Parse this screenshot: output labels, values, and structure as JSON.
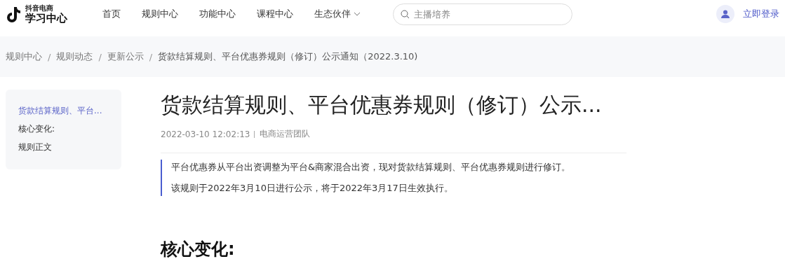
{
  "logo": {
    "subtitle": "抖音电商",
    "title": "学习中心"
  },
  "nav": [
    {
      "label": "首页",
      "dropdown": false
    },
    {
      "label": "规则中心",
      "dropdown": false
    },
    {
      "label": "功能中心",
      "dropdown": false
    },
    {
      "label": "课程中心",
      "dropdown": false
    },
    {
      "label": "生态伙伴",
      "dropdown": true
    }
  ],
  "search": {
    "placeholder": "主播培养"
  },
  "login": "立即登录",
  "breadcrumb_separator": "/",
  "breadcrumb": [
    "规则中心",
    "规则动态",
    "更新公示",
    "货款结算规则、平台优惠券规则（修订）公示通知（2022.3.10)"
  ],
  "toc": [
    {
      "label": "货款结算规则、平台...",
      "selected": true
    },
    {
      "label": "核心变化:",
      "selected": false
    },
    {
      "label": "规则正文",
      "selected": false
    }
  ],
  "article": {
    "title": "货款结算规则、平台优惠券规则（修订）公示...",
    "date": "2022-03-10 12:02:13",
    "author": "电商运营团队",
    "summary": [
      "平台优惠券从平台出资调整为平台&商家混合出资，现对货款结算规则、平台优惠券规则进行修订。",
      "该规则于2022年3月10日进行公示，将于2022年3月17日生效执行。"
    ],
    "heading": "核心变化:"
  }
}
